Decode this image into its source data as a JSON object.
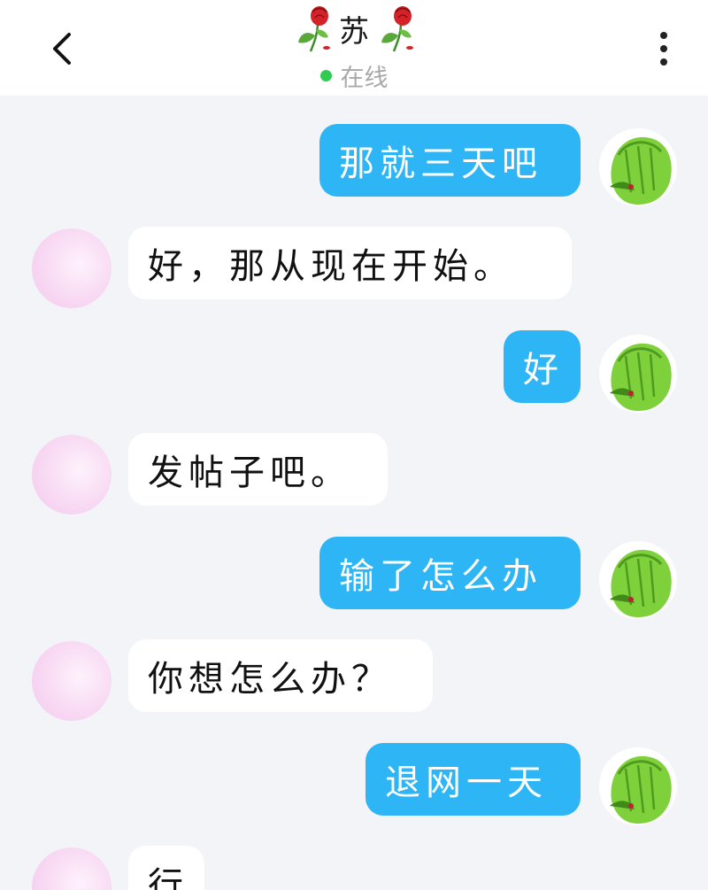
{
  "header": {
    "title": "苏",
    "status": "在线",
    "colors": {
      "online": "#2ecc52",
      "accent": "#2eb5f5"
    }
  },
  "icons": {
    "back": "chevron-left-icon",
    "more": "more-vertical-icon",
    "title_decoration": "rose-icon"
  },
  "messages": [
    {
      "from": "me",
      "text": "那就三天吧"
    },
    {
      "from": "other",
      "text": "好，那从现在开始。"
    },
    {
      "from": "me",
      "text": "好"
    },
    {
      "from": "other",
      "text": "发帖子吧。"
    },
    {
      "from": "me",
      "text": "输了怎么办"
    },
    {
      "from": "other",
      "text": "你想怎么办？"
    },
    {
      "from": "me",
      "text": "退网一天"
    },
    {
      "from": "other",
      "text": "行"
    }
  ]
}
